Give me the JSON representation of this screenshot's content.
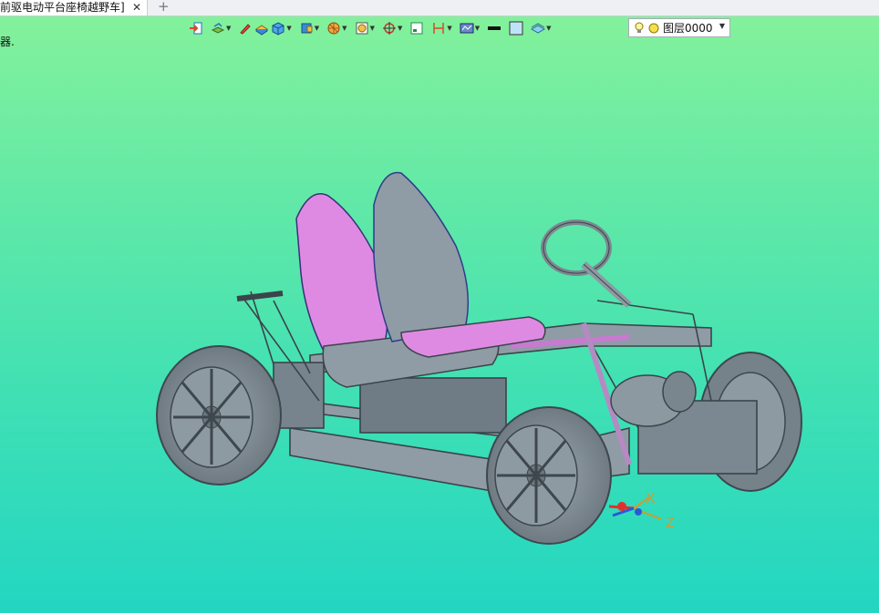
{
  "tab": {
    "title": "前驱电动平台座椅越野车]",
    "close": "✕",
    "add": "+"
  },
  "side_text": "器.",
  "toolbar": {
    "items": [
      {
        "name": "import-icon",
        "dropdown": false
      },
      {
        "name": "layer-stack-icon",
        "dropdown": true
      },
      {
        "name": "pencil-icon",
        "dropdown": false
      },
      {
        "name": "layer-solid-icon",
        "dropdown": false
      },
      {
        "name": "cube-icon",
        "dropdown": true
      },
      {
        "name": "view-cube-icon",
        "dropdown": true
      },
      {
        "name": "sphere-render-icon",
        "dropdown": true
      },
      {
        "name": "zoom-fit-icon",
        "dropdown": true
      },
      {
        "name": "crosshair-icon",
        "dropdown": true
      },
      {
        "name": "frame-icon",
        "dropdown": false
      },
      {
        "name": "dimension-icon",
        "dropdown": true
      },
      {
        "name": "display-settings-icon",
        "dropdown": true
      },
      {
        "name": "line-color-icon",
        "dropdown": false
      },
      {
        "name": "fill-color-icon",
        "dropdown": false
      },
      {
        "name": "layers-icon",
        "dropdown": true
      }
    ],
    "dropdown_glyph": "▼"
  },
  "layer": {
    "label": "图层0000",
    "caret": "▼",
    "bulb_icon": "bulb-icon",
    "sun_icon": "sun-icon"
  },
  "triad": {
    "x_label": "X",
    "z_label": "Z"
  },
  "colors": {
    "accent_pink": "#e08be6",
    "frame_gray": "#8c9aa4",
    "axis_orange": "#d69a2a"
  }
}
